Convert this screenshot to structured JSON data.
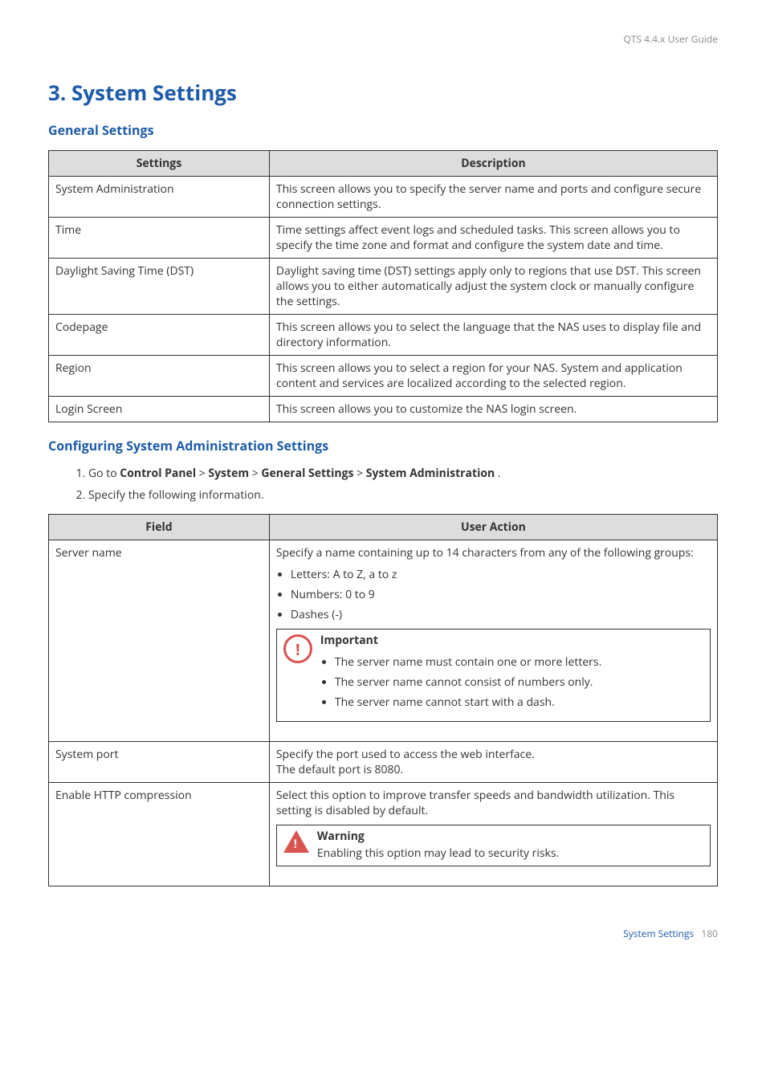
{
  "header": {
    "guide_title": "QTS 4.4.x User Guide"
  },
  "chapter": {
    "title": "3. System Settings"
  },
  "general": {
    "heading": "General Settings",
    "table_headers": {
      "settings": "Settings",
      "description": "Description"
    },
    "rows": [
      {
        "name": "System Administration",
        "desc": "This screen allows you to specify the server name and ports and configure secure connection settings."
      },
      {
        "name": "Time",
        "desc": "Time settings affect event logs and scheduled tasks. This screen allows you to specify the time zone and format and configure the system date and time."
      },
      {
        "name": "Daylight Saving Time (DST)",
        "desc": "Daylight saving time (DST) settings apply only to regions that use DST. This screen allows you to either automatically adjust the system clock or manually configure the settings."
      },
      {
        "name": "Codepage",
        "desc": "This screen allows you to select the language that the NAS uses to display file and directory information."
      },
      {
        "name": "Region",
        "desc": "This screen allows you to select a region for your NAS. System and application content and services are localized according to the selected region."
      },
      {
        "name": "Login Screen",
        "desc": "This screen allows you to customize the NAS login screen."
      }
    ]
  },
  "config": {
    "heading": "Configuring System Administration Settings",
    "step1_prefix": "Go to ",
    "step1_path": [
      "Control Panel",
      "System",
      "General Settings",
      "System Administration"
    ],
    "step1_sep": " > ",
    "step1_suffix": " .",
    "step2": "Specify the following information.",
    "table_headers": {
      "field": "Field",
      "action": "User Action"
    },
    "rows": {
      "server_name": {
        "field": "Server name",
        "intro": "Specify a name containing up to 14 characters from any of the following groups:",
        "bullets": [
          "Letters: A to Z, a to z",
          "Numbers: 0 to 9",
          "Dashes (-)"
        ],
        "important_label": "Important",
        "important_bullets": [
          "The server name must contain one or more letters.",
          "The server name cannot consist of numbers only.",
          "The server name cannot start with a dash."
        ]
      },
      "system_port": {
        "field": "System port",
        "line1": "Specify the port used to access the web interface.",
        "line2": "The default port is 8080."
      },
      "http_compression": {
        "field": "Enable HTTP compression",
        "desc": "Select this option to improve transfer speeds and bandwidth utilization. This setting is disabled by default.",
        "warning_label": "Warning",
        "warning_text": "Enabling this option may lead to security risks."
      }
    }
  },
  "footer": {
    "section": "System Settings",
    "page": "180"
  }
}
